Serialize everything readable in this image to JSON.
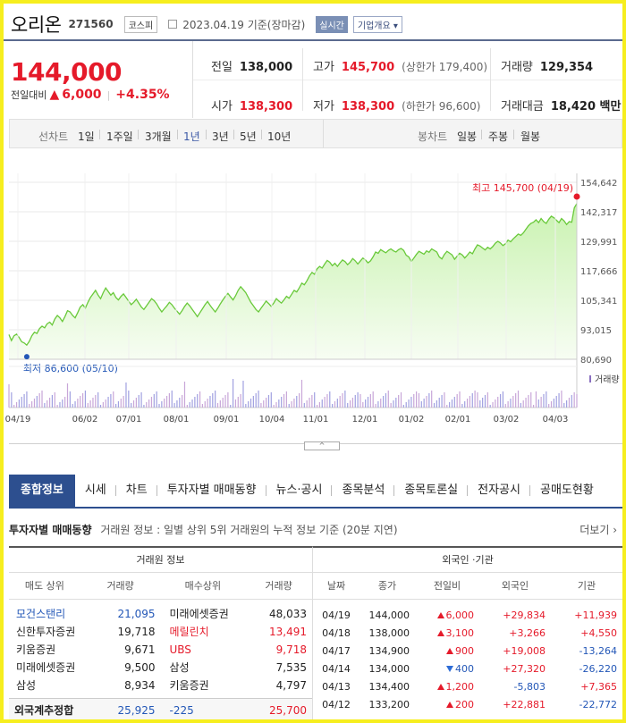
{
  "header": {
    "name": "오리온",
    "code": "271560",
    "market": "코스피",
    "date": "2023.04.19 기준(장마감)",
    "live_label": "실시간",
    "company_info_label": "기업개요"
  },
  "price": {
    "current": "144,000",
    "change_label": "전일대비",
    "change": "6,000",
    "change_pct": "+4.35%"
  },
  "stats": {
    "prev_label": "전일",
    "prev": "138,000",
    "high_label": "고가",
    "high": "145,700",
    "high_limit": "(상한가 179,400)",
    "volume_label": "거래량",
    "volume": "129,354",
    "open_label": "시가",
    "open": "138,300",
    "low_label": "저가",
    "low": "138,300",
    "low_limit": "(하한가 96,600)",
    "amount_label": "거래대금",
    "amount": "18,420 백만"
  },
  "period": {
    "line_label": "선차트",
    "options": [
      "1일",
      "1주일",
      "3개월",
      "1년",
      "3년",
      "5년",
      "10년"
    ],
    "active": "1년",
    "candle_label": "봉차트",
    "candle_options": [
      "일봉",
      "주봉",
      "월봉"
    ]
  },
  "chart_data": {
    "type": "area",
    "y_ticks": [
      "154,642",
      "142,317",
      "129,991",
      "117,666",
      "105,341",
      "93,015",
      "80,690"
    ],
    "ylim": [
      80690,
      154642
    ],
    "x_ticks": [
      "04/19",
      "06/02",
      "07/01",
      "08/01",
      "09/01",
      "10/04",
      "11/01",
      "12/01",
      "01/02",
      "02/01",
      "03/02",
      "04/03"
    ],
    "high_annotation": "최고 145,700 (04/19)",
    "low_annotation": "최저 86,600 (05/10)",
    "volume_label": "거래량",
    "series": [
      {
        "values": [
          91000,
          88500,
          90500,
          91200,
          89800,
          88000,
          87500,
          86600,
          88200,
          90500,
          92000,
          91500,
          93500,
          94500,
          93800,
          95500,
          96200,
          95000,
          97500,
          99000,
          98000,
          96500,
          98500,
          101000,
          100500,
          99000,
          98000,
          100200,
          102500,
          103500,
          102000,
          104500,
          106500,
          108000,
          109500,
          107500,
          106000,
          108500,
          110500,
          109000,
          107500,
          108500,
          106500,
          105500,
          107000,
          108000,
          106500,
          105000,
          103500,
          104500,
          105800,
          104200,
          102500,
          101500,
          103000,
          104500,
          106000,
          105200,
          103800,
          102000,
          100500,
          101800,
          103000,
          104500,
          103500,
          102000,
          100800,
          99500,
          101000,
          102800,
          104200,
          103000,
          101500,
          100000,
          98500,
          100200,
          101800,
          103500,
          104800,
          103200,
          101800,
          100500,
          102000,
          103800,
          105500,
          107000,
          108200,
          106800,
          105500,
          107200,
          109500,
          111000,
          109800,
          108500,
          106500,
          104500,
          103000,
          101500,
          100500,
          102000,
          103500,
          105000,
          104000,
          102800,
          104200,
          106000,
          105000,
          104200,
          105500,
          107000,
          106200,
          107800,
          109500,
          108800,
          110500,
          112500,
          111800,
          113500,
          115500,
          117000,
          116200,
          118500,
          119500,
          118800,
          120500,
          122000,
          121200,
          119800,
          120800,
          119500,
          121000,
          122200,
          121500,
          120200,
          121300,
          122800,
          121800,
          120500,
          121800,
          123000,
          122200,
          121000,
          121800,
          123500,
          125500,
          125000,
          126500,
          125800,
          125200,
          126200,
          126800,
          126000,
          125500,
          126500,
          127000,
          126200,
          124200,
          123500,
          121500,
          123000,
          124500,
          125800,
          125200,
          124600,
          126000,
          125400,
          126800,
          126200,
          125500,
          123500,
          122600,
          124500,
          125800,
          125100,
          124300,
          122500,
          123800,
          125000,
          124300,
          123000,
          124200,
          125500,
          124800,
          126800,
          128500,
          128000,
          127200,
          126400,
          127500,
          126800,
          127800,
          129200,
          130000,
          129300,
          128200,
          129000,
          130500,
          129800,
          131000,
          132000,
          133000,
          132500,
          133500,
          135000,
          136500,
          137500,
          138000,
          139000,
          137800,
          139500,
          138200,
          137500,
          139200,
          140500,
          139800,
          138800,
          137800,
          139500,
          138500,
          137000,
          138200,
          138000,
          144000,
          145700
        ]
      }
    ]
  },
  "toggle_label": "^",
  "tabs": [
    "종합정보",
    "시세",
    "차트",
    "투자자별 매매동향",
    "뉴스·공시",
    "종목분석",
    "종목토론실",
    "전자공시",
    "공매도현황"
  ],
  "active_tab": "종합정보",
  "trading": {
    "title": "투자자별 매매동향",
    "desc": "거래원 정보 : 일별 상위 5위 거래원의 누적 정보 기준 (20분 지연)",
    "more": "더보기",
    "broker_header": "거래원 정보",
    "broker_cols": [
      "매도 상위",
      "거래량",
      "매수상위",
      "거래량"
    ],
    "broker_rows": [
      [
        "모건스탠리",
        "21,095",
        "미래에셋증권",
        "48,033"
      ],
      [
        "신한투자증권",
        "19,718",
        "메릴린치",
        "13,491"
      ],
      [
        "키움증권",
        "9,671",
        "UBS",
        "9,718"
      ],
      [
        "미래에셋증권",
        "9,500",
        "삼성",
        "7,535"
      ],
      [
        "삼성",
        "8,934",
        "키움증권",
        "4,797"
      ]
    ],
    "foreign_sum": [
      "외국계추정합",
      "25,925",
      "-225",
      "25,700"
    ],
    "inst_header": "외국인 ·기관",
    "inst_cols": [
      "날짜",
      "종가",
      "전일비",
      "외국인",
      "기관"
    ],
    "inst_rows": [
      [
        "04/19",
        "144,000",
        "6,000",
        "+29,834",
        "+11,939"
      ],
      [
        "04/18",
        "138,000",
        "3,100",
        "+3,266",
        "+4,550"
      ],
      [
        "04/17",
        "134,900",
        "900",
        "+19,008",
        "-13,264"
      ],
      [
        "04/14",
        "134,000",
        "400",
        "+27,320",
        "-26,220"
      ],
      [
        "04/13",
        "134,400",
        "1,200",
        "-5,803",
        "+7,365"
      ],
      [
        "04/12",
        "133,200",
        "200",
        "+22,881",
        "-22,772"
      ]
    ],
    "inst_dirs": [
      "up",
      "up",
      "up",
      "down",
      "up",
      "up"
    ]
  }
}
